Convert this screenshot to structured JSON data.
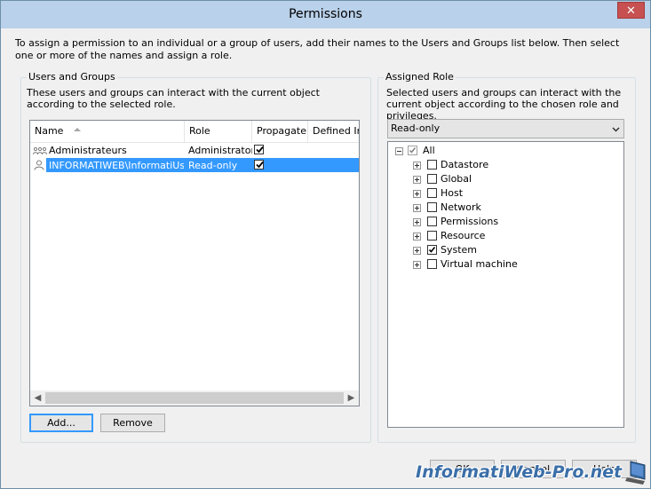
{
  "window": {
    "title": "Permissions",
    "close_label": "✕"
  },
  "intro_text": "To assign a permission to an individual or a group of users, add their names to the Users and Groups list below. Then select one or more of the names and assign a role.",
  "users_groups": {
    "label": "Users and Groups",
    "description": "These users and groups can interact with the current object according to the selected role.",
    "columns": [
      "Name",
      "Role",
      "Propagate",
      "Defined In"
    ],
    "rows": [
      {
        "name": "Administrateurs",
        "role": "Administrator",
        "propagate": true,
        "icon": "group-icon",
        "selected": false
      },
      {
        "name": "INFORMATIWEB\\InformatiUser",
        "role": "Read-only",
        "propagate": true,
        "icon": "user-icon",
        "selected": true
      }
    ],
    "add_label": "Add...",
    "remove_label": "Remove"
  },
  "assigned_role": {
    "label": "Assigned Role",
    "description": "Selected users and groups can interact with the current object according to the chosen role and privileges.",
    "role_value": "Read-only",
    "tree": {
      "root": {
        "label": "All",
        "checked": true
      },
      "children": [
        {
          "label": "Datastore",
          "checked": false
        },
        {
          "label": "Global",
          "checked": false
        },
        {
          "label": "Host",
          "checked": false
        },
        {
          "label": "Network",
          "checked": false
        },
        {
          "label": "Permissions",
          "checked": false
        },
        {
          "label": "Resource",
          "checked": false
        },
        {
          "label": "System",
          "checked": true
        },
        {
          "label": "Virtual machine",
          "checked": false
        }
      ]
    }
  },
  "footer": {
    "ok_label": "OK",
    "cancel_label": "Cancel",
    "help_label": "Help"
  },
  "watermark": "InformatiWeb-Pro.net",
  "colors": {
    "titlebar": "#b9d1ea",
    "selection": "#3399ff",
    "close": "#c75050"
  }
}
